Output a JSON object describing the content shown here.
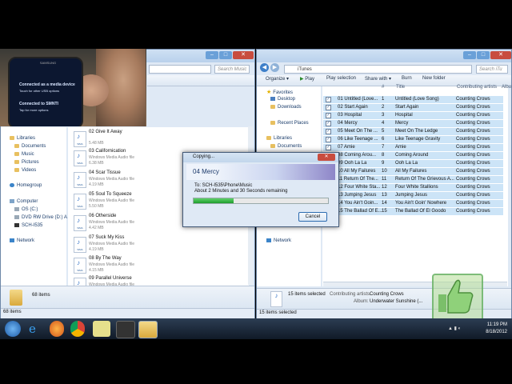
{
  "left_window": {
    "search_placeholder": "Search Music",
    "nav": [
      "Libraries",
      "Documents",
      "Music",
      "Pictures",
      "Videos",
      "Homegroup",
      "Computer",
      "OS (C:)",
      "DVD RW Drive (D:) A",
      "SCH-I535",
      "Network"
    ],
    "files": [
      {
        "name": "02 Give It Away",
        "type": "",
        "size": "5.48 MB"
      },
      {
        "name": "03 Californication",
        "type": "Windows Media Audio file",
        "size": "6.38 MB"
      },
      {
        "name": "04 Scar Tissue",
        "type": "Windows Media Audio file",
        "size": "4.19 MB"
      },
      {
        "name": "05 Soul To Squeeze",
        "type": "Windows Media Audio file",
        "size": "5.50 MB"
      },
      {
        "name": "06 Otherside",
        "type": "Windows Media Audio file",
        "size": "4.42 MB"
      },
      {
        "name": "07 Suck My Kiss",
        "type": "Windows Media Audio file",
        "size": "4.19 MB"
      },
      {
        "name": "08 By The Way",
        "type": "Windows Media Audio file",
        "size": "4.15 MB"
      },
      {
        "name": "09 Parallel Universe",
        "type": "Windows Media Audio file",
        "size": ""
      }
    ],
    "icon_label": "WMA",
    "details_count": "68 items",
    "status": "68 items"
  },
  "phone": {
    "brand": "SAMSUNG",
    "lines": [
      "Connected as a media device",
      "Touch for other USB options",
      "Connected to SMNTI",
      "Tap for more options"
    ]
  },
  "right_window": {
    "breadcrumb": "iTunes",
    "search_placeholder": "Search iTu",
    "toolbar": [
      "Organize ▾",
      "Play",
      "Play selection",
      "Share with ▾",
      "Burn",
      "New folder"
    ],
    "favorites_label": "Favorites",
    "nav": [
      "Desktop",
      "Downloads",
      "Recent Places",
      "Libraries",
      "Documents",
      "Music",
      "Pictures",
      "Videos",
      "Homegroup",
      "Computer",
      "OS (C:)",
      "DVD RW Drive (D:) A",
      "SCH-I535",
      "Network"
    ],
    "columns": [
      "#",
      "Title",
      "Contributing artists",
      "Albu"
    ],
    "rows": [
      {
        "name": "01 Untitled (Love...",
        "num": "1",
        "title": "Untitled (Love Song)",
        "artist": "Counting Crows"
      },
      {
        "name": "02 Start Again",
        "num": "2",
        "title": "Start Again",
        "artist": "Counting Crows"
      },
      {
        "name": "03 Hospital",
        "num": "3",
        "title": "Hospital",
        "artist": "Counting Crows"
      },
      {
        "name": "04 Mercy",
        "num": "4",
        "title": "Mercy",
        "artist": "Counting Crows"
      },
      {
        "name": "05 Meet On The ...",
        "num": "5",
        "title": "Meet On The Ledge",
        "artist": "Counting Crows"
      },
      {
        "name": "06 Like Teenage ...",
        "num": "6",
        "title": "Like Teenage Gravity",
        "artist": "Counting Crows"
      },
      {
        "name": "07 Amie",
        "num": "7",
        "title": "Amie",
        "artist": "Counting Crows"
      },
      {
        "name": "08 Coming Arou...",
        "num": "8",
        "title": "Coming Around",
        "artist": "Counting Crows"
      },
      {
        "name": "09 Ooh La La",
        "num": "9",
        "title": "Ooh La La",
        "artist": "Counting Crows"
      },
      {
        "name": "10 All My Failures",
        "num": "10",
        "title": "All My Failures",
        "artist": "Counting Crows"
      },
      {
        "name": "11 Return Of The...",
        "num": "11",
        "title": "Return Of The Grievous A...",
        "artist": "Counting Crows"
      },
      {
        "name": "12 Four White Sta...",
        "num": "12",
        "title": "Four White Stallions",
        "artist": "Counting Crows"
      },
      {
        "name": "13 Jumping Jesus",
        "num": "13",
        "title": "Jumping Jesus",
        "artist": "Counting Crows"
      },
      {
        "name": "14 You Ain't Goin...",
        "num": "14",
        "title": "You Ain't Goin' Nowhere",
        "artist": "Counting Crows"
      },
      {
        "name": "15 The Ballad Of E...",
        "num": "15",
        "title": "The Ballad Of El Goodo",
        "artist": "Counting Crows"
      }
    ],
    "details_line1": "15 items selected",
    "details_label1": "Contributing artists:",
    "details_value1": "Counting Crows",
    "details_label2": "Album:",
    "details_value2": "Underwater Sunshine (...",
    "status": "15 items selected"
  },
  "copy_dialog": {
    "title": "Copying...",
    "filename": "04 Mercy",
    "to": "To: SCH-I535\\Phone\\Music",
    "remaining": "About 2 Minutes and 30 Seconds remaining",
    "progress": 0.3,
    "cancel": "Cancel"
  },
  "taskbar": {
    "time": "11:19 PM",
    "date": "8/18/2012"
  },
  "colors": {
    "accent": "#3a7bd5",
    "progress": "#1e9c2d"
  }
}
